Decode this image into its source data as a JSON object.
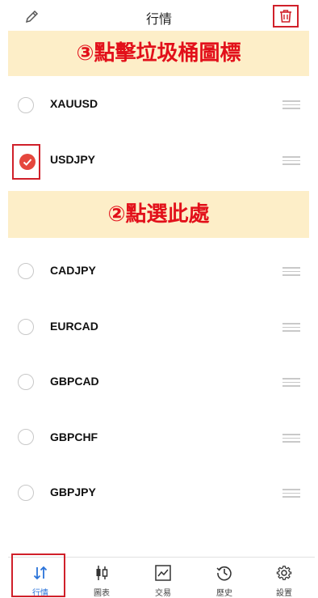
{
  "header": {
    "title": "行情"
  },
  "annotations": {
    "step3": "③點擊垃圾桶圖標",
    "step2": "②點選此處"
  },
  "symbols": [
    {
      "name": "XAUUSD",
      "checked": false
    },
    {
      "name": "USDJPY",
      "checked": true
    },
    {
      "name": "CADJPY",
      "checked": false
    },
    {
      "name": "EURCAD",
      "checked": false
    },
    {
      "name": "GBPCAD",
      "checked": false
    },
    {
      "name": "GBPCHF",
      "checked": false
    },
    {
      "name": "GBPJPY",
      "checked": false
    }
  ],
  "tabs": [
    {
      "label": "行情",
      "icon": "quotes-arrows-icon",
      "active": true
    },
    {
      "label": "圖表",
      "icon": "chart-candles-icon",
      "active": false
    },
    {
      "label": "交易",
      "icon": "trade-line-icon",
      "active": false
    },
    {
      "label": "歷史",
      "icon": "history-clock-icon",
      "active": false
    },
    {
      "label": "設置",
      "icon": "gear-icon",
      "active": false
    }
  ],
  "colors": {
    "accent": "#2a73d9",
    "highlight": "#d0202a",
    "banner": "#fdeec8",
    "check": "#e5473d"
  }
}
